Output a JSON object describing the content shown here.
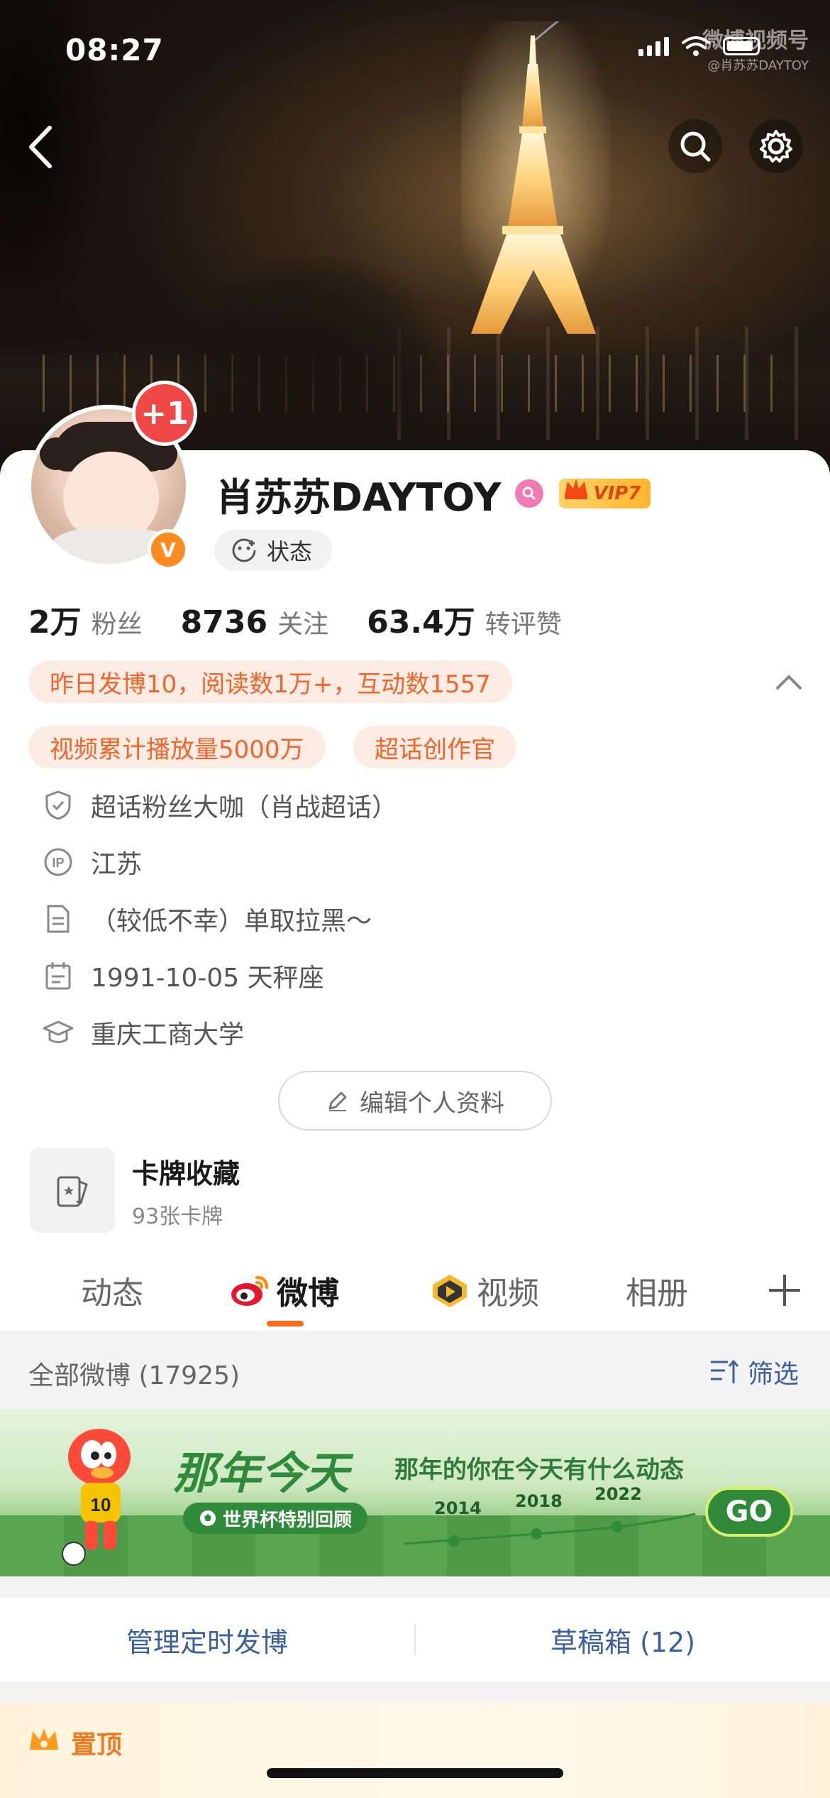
{
  "status_bar": {
    "time": "08:27"
  },
  "watermark": {
    "line1": "微博视频号",
    "line2": "@肖苏苏DAYTOY"
  },
  "profile": {
    "plus_badge": "+1",
    "verify_mark": "V",
    "name": "肖苏苏DAYTOY",
    "vip_label": "VIP7",
    "status_label": "状态",
    "stats": [
      {
        "value": "2万",
        "label": "粉丝"
      },
      {
        "value": "8736",
        "label": "关注"
      },
      {
        "value": "63.4万",
        "label": "转评赞"
      }
    ],
    "pills": {
      "yesterday": "昨日发博10，阅读数1万+，互动数1557",
      "video": "视频累计播放量5000万",
      "creator": "超话创作官"
    },
    "info": {
      "fan": "超话粉丝大咖（肖战超话）",
      "ip": "江苏",
      "bio": "（较低不幸）单取拉黑～",
      "birthday": "1991-10-05 天秤座",
      "school": "重庆工商大学"
    },
    "edit_label": "编辑个人资料",
    "cards_title": "卡牌收藏",
    "cards_sub": "93张卡牌"
  },
  "tabs": {
    "t1": "动态",
    "t2": "微博",
    "t3": "视频",
    "t4": "相册"
  },
  "feed": {
    "header": "全部微博 (17925)",
    "filter": "筛选",
    "banner": {
      "title": "那年今天",
      "subtitle": "那年的你在今天有什么动态",
      "worldcup": "世界杯特别回顾",
      "years": [
        "2014",
        "2018",
        "2022"
      ],
      "go": "GO"
    },
    "actions": {
      "scheduled": "管理定时发博",
      "drafts": "草稿箱 (12)"
    },
    "pinned": "置顶"
  },
  "colors": {
    "accent": "#ff6b1a",
    "link": "#3b5f9e",
    "pill_bg": "#fdece3",
    "pill_text": "#f0652a"
  },
  "icons": [
    "back-icon",
    "search-icon",
    "settings-icon",
    "status-icon",
    "shield-icon",
    "ip-icon",
    "note-icon",
    "calendar-icon",
    "school-icon",
    "pencil-icon",
    "card-icon",
    "weibo-icon",
    "video-icon",
    "plus-icon",
    "filter-icon",
    "crown-icon"
  ]
}
